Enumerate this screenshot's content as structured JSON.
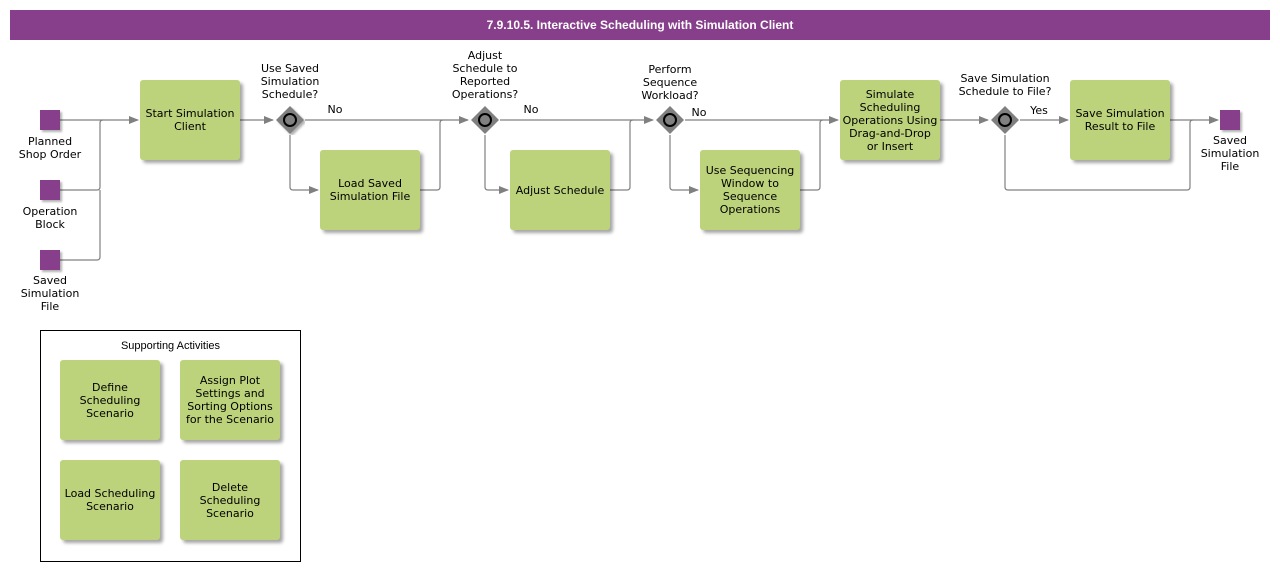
{
  "title": "7.9.10.5. Interactive Scheduling with Simulation Client",
  "colors": {
    "title_bar": "#873f8b",
    "task_fill": "#bcd37c",
    "data_object": "#873f8b",
    "connector": "#808080",
    "gateway": "#808080"
  },
  "inputs": [
    {
      "label": "Planned\nShop Order"
    },
    {
      "label": "Operation\nBlock"
    },
    {
      "label": "Saved\nSimulation\nFile"
    }
  ],
  "output": {
    "label": "Saved\nSimulation\nFile"
  },
  "tasks": {
    "start": "Start Simulation\nClient",
    "load_saved": "Load Saved\nSimulation File",
    "adjust": "Adjust Schedule",
    "sequencing": "Use Sequencing\nWindow to\nSequence\nOperations",
    "simulate": "Simulate\nScheduling\nOperations Using\nDrag-and-Drop\nor Insert",
    "save_result": "Save Simulation\nResult to File"
  },
  "gateways": [
    {
      "question": "Use Saved\nSimulation\nSchedule?",
      "branch_label": "No"
    },
    {
      "question": "Adjust\nSchedule to\nReported\nOperations?",
      "branch_label": "No"
    },
    {
      "question": "Perform\nSequence\nWorkload?",
      "branch_label": "No"
    },
    {
      "question": "Save Simulation\nSchedule to File?",
      "branch_label": "Yes"
    }
  ],
  "supporting": {
    "title": "Supporting Activities",
    "items": [
      "Define\nScheduling\nScenario",
      "Assign Plot\nSettings and\nSorting Options\nfor the Scenario",
      "Load Scheduling\nScenario",
      "Delete\nScheduling\nScenario"
    ]
  }
}
